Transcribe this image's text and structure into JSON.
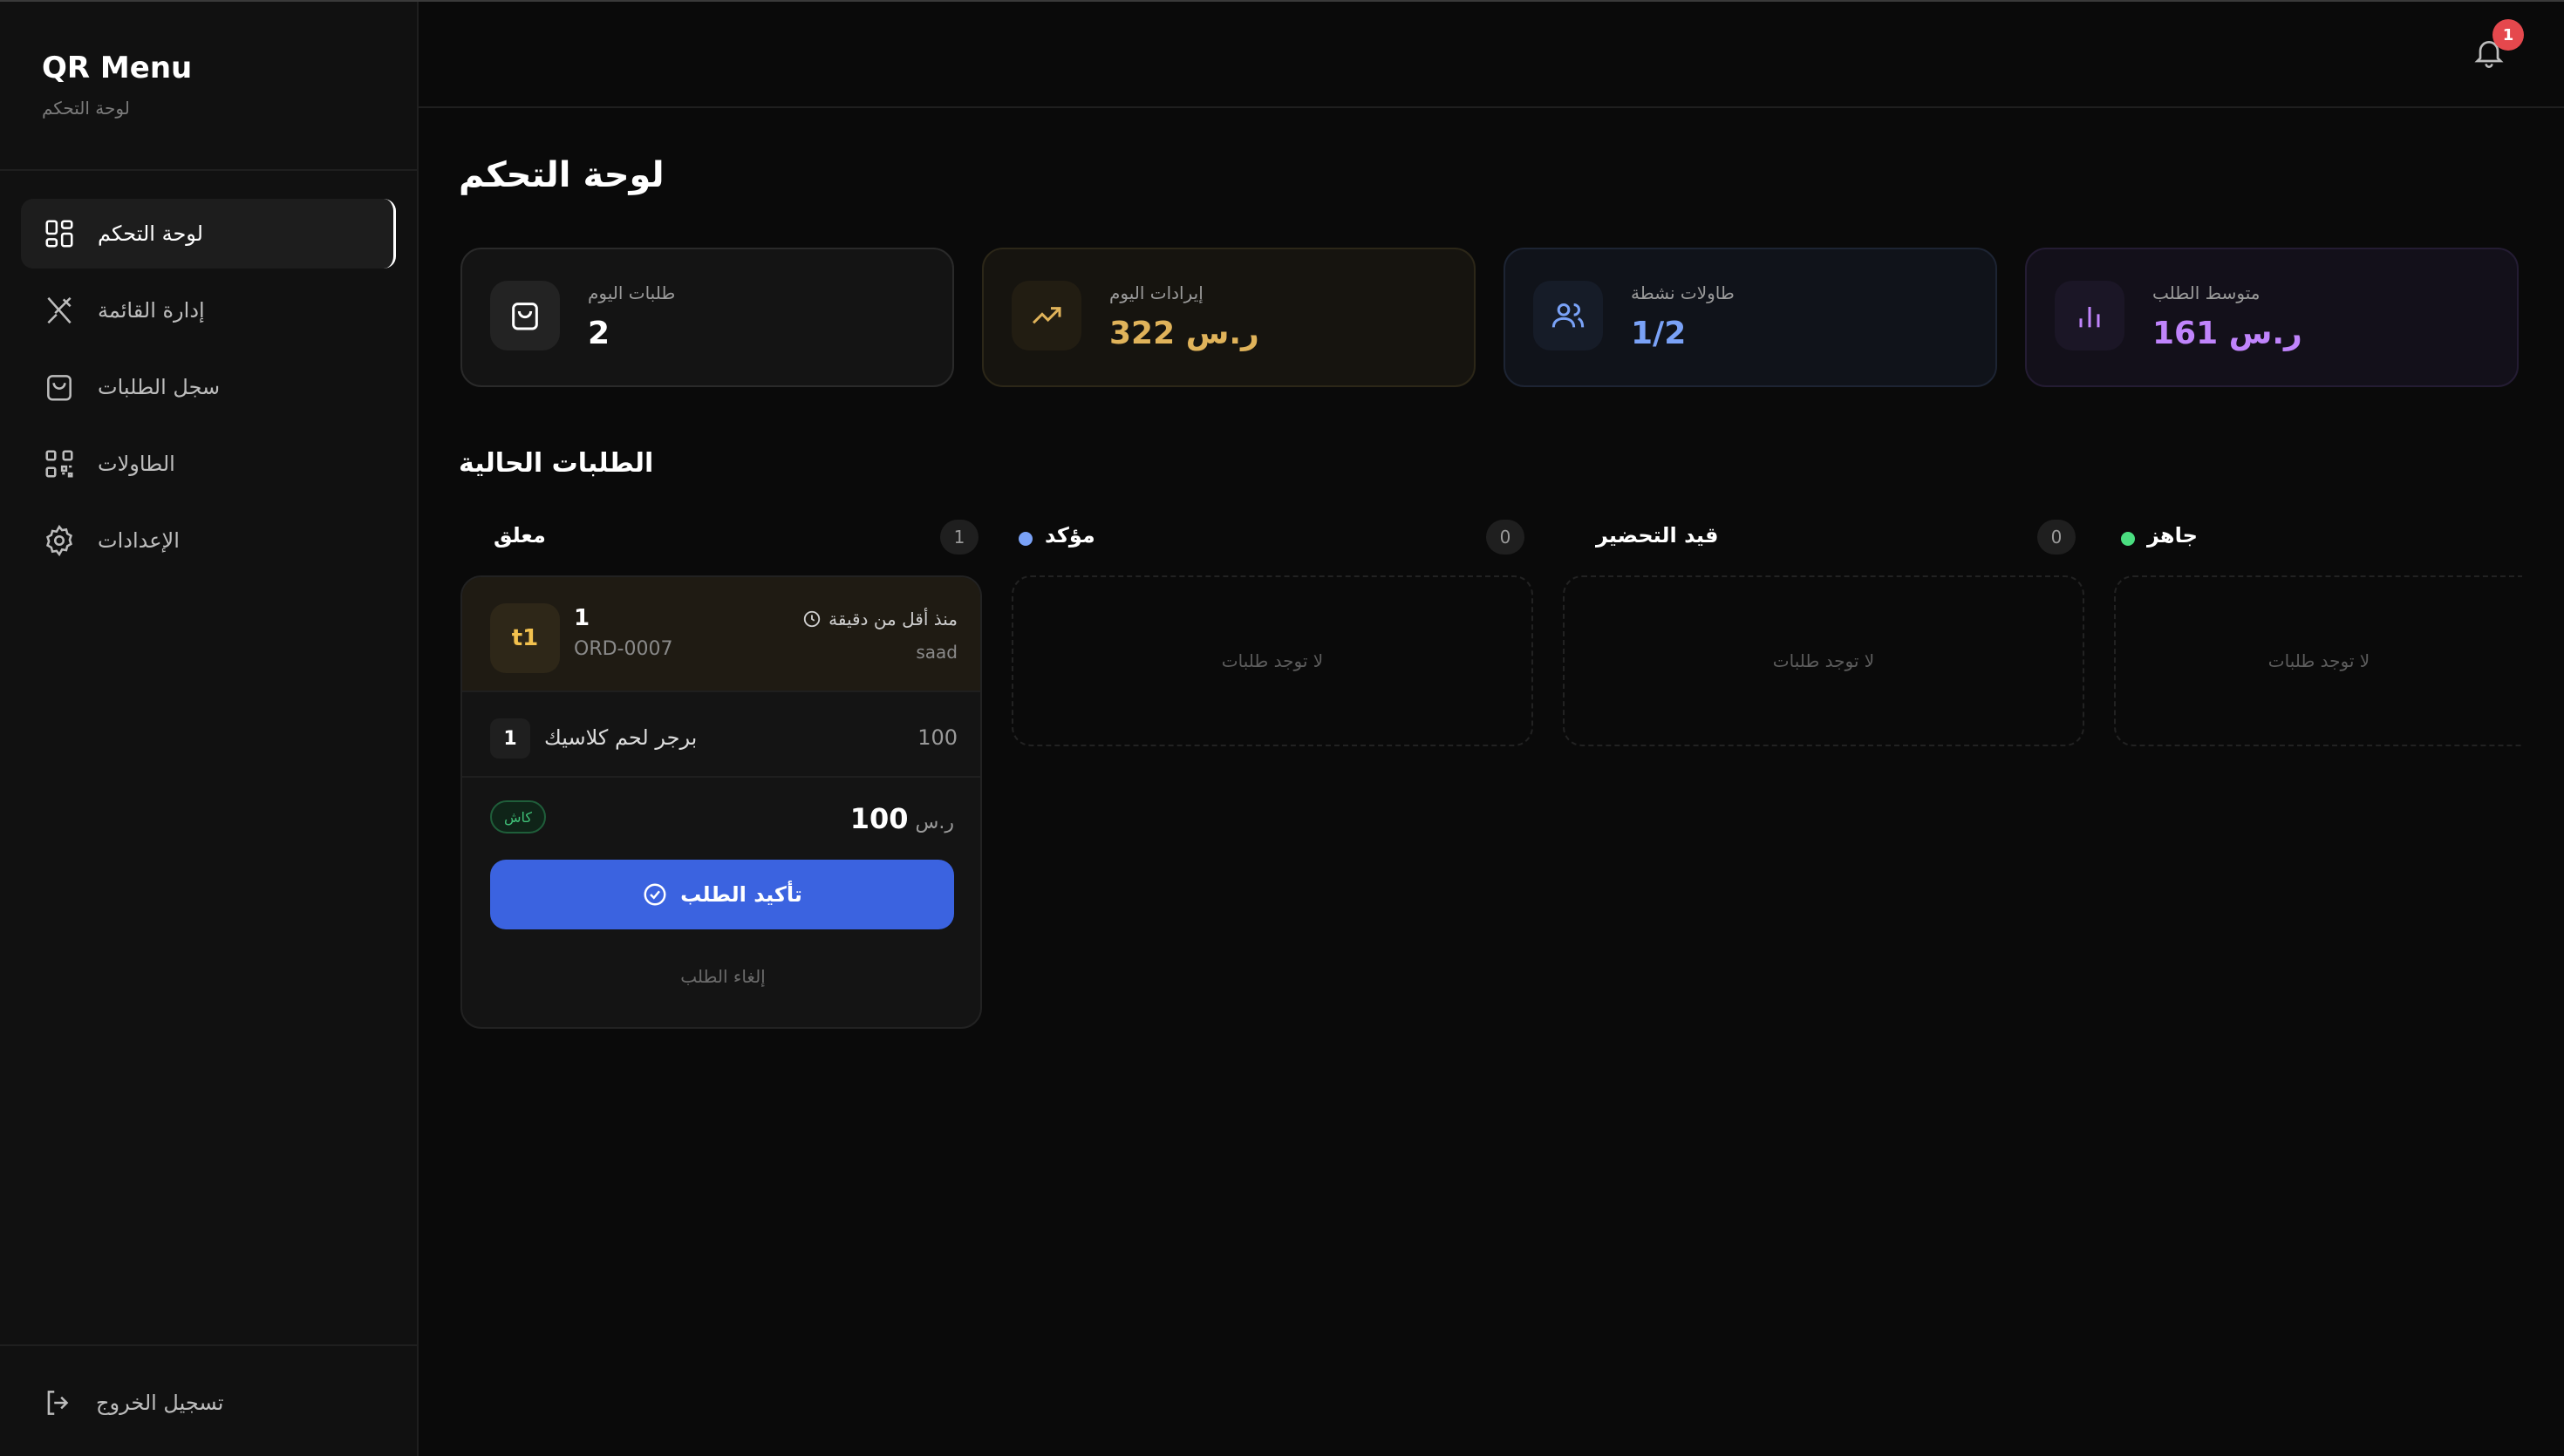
{
  "sidebar": {
    "brand_title": "QR Menu",
    "brand_subtitle": "لوحة التحكم",
    "items": [
      {
        "label": "لوحة التحكم",
        "icon": "grid-icon",
        "active": true
      },
      {
        "label": "إدارة القائمة",
        "icon": "utensils-icon",
        "active": false
      },
      {
        "label": "سجل الطلبات",
        "icon": "shopping-bag-icon",
        "active": false
      },
      {
        "label": "الطاولات",
        "icon": "qr-code-icon",
        "active": false
      },
      {
        "label": "الإعدادات",
        "icon": "gear-icon",
        "active": false
      }
    ],
    "logout_label": "تسجيل الخروج"
  },
  "header": {
    "notification_count": "1"
  },
  "main": {
    "page_title": "لوحة التحكم",
    "stats": [
      {
        "label": "طلبات اليوم",
        "value": "2",
        "icon": "shopping-bag-icon",
        "accent": "#ffffff"
      },
      {
        "label": "إيرادات اليوم",
        "value": "322 ر.س",
        "icon": "trending-up-icon",
        "accent": "#e0b35a"
      },
      {
        "label": "طاولات نشطة",
        "value": "1/2",
        "icon": "users-icon",
        "accent": "#7aa2f7"
      },
      {
        "label": "متوسط الطلب",
        "value": "161 ر.س",
        "icon": "bar-chart-icon",
        "accent": "#c084fc"
      }
    ],
    "section_title": "الطلبات الحالية",
    "columns": [
      {
        "name": "معلق",
        "count": "1",
        "dot_color": ""
      },
      {
        "name": "مؤكد",
        "count": "0",
        "dot_color": "#7aa2f7",
        "empty_text": "لا توجد طلبات"
      },
      {
        "name": "قيد التحضير",
        "count": "0",
        "dot_color": "",
        "empty_text": "لا توجد طلبات"
      },
      {
        "name": "جاهز",
        "count": "",
        "dot_color": "#4ade80",
        "empty_text": "لا توجد طلبات"
      }
    ],
    "order": {
      "table_badge": "t1",
      "number": "1",
      "id": "ORD-0007",
      "time": "منذ أقل من دقيقة",
      "customer": "saad",
      "items": [
        {
          "qty": "1",
          "name": "برجر لحم كلاسيك",
          "price": "100"
        }
      ],
      "payment": "كاش",
      "total": "100",
      "currency": "ر.س",
      "confirm_label": "تأكيد الطلب",
      "cancel_label": "إلغاء الطلب"
    }
  },
  "colors": {
    "background": "#0a0a0a",
    "primary_button": "#3b63e0",
    "notification_badge": "#e5484d"
  }
}
